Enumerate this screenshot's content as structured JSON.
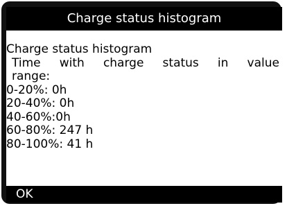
{
  "window": {
    "title": "Charge status histogram"
  },
  "content": {
    "heading": "Charge status histogram",
    "description_line1": "Time with charge status in value",
    "description_line2": "range:",
    "ranges": [
      {
        "text": "0-20%: 0h"
      },
      {
        "text": "20-40%: 0h"
      },
      {
        "text": "40-60%:0h"
      },
      {
        "text": "60-80%: 247 h"
      },
      {
        "text": "80-100%: 41 h"
      }
    ]
  },
  "footer": {
    "ok_label": "OK"
  },
  "colors": {
    "bezel": "#111111",
    "bar": "#000000",
    "screen": "#ffffff",
    "text": "#000000"
  }
}
